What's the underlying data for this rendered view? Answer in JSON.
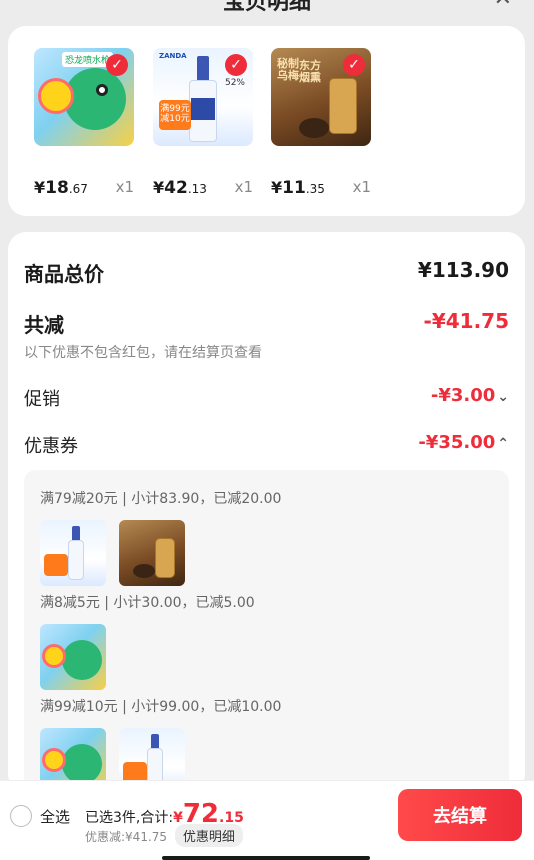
{
  "header": {
    "title": "宝贝明细",
    "close_icon": "close-icon"
  },
  "products": [
    {
      "price_symbol": "¥",
      "price_int": "18",
      "price_dec": ".67",
      "qty": "x1",
      "thumb": "water-gun-toy",
      "tag": "恐龙喷水枪"
    },
    {
      "price_symbol": "¥",
      "price_int": "42",
      "price_dec": ".13",
      "qty": "x1",
      "thumb": "liquor-bottle",
      "promo_head": "ZANDA",
      "promo_tag": "满99元减10元",
      "abv": "52%"
    },
    {
      "price_symbol": "¥",
      "price_int": "11",
      "price_dec": ".35",
      "qty": "x1",
      "thumb": "smoked-plum-drink",
      "plum_text_1": "秘制乌梅",
      "plum_text_2": "东方烟熏"
    }
  ],
  "detail": {
    "total_label": "商品总价",
    "total_value": "¥113.90",
    "reduce_label": "共减",
    "reduce_value": "-¥41.75",
    "note": "以下优惠不包含红包，请在结算页查看",
    "promo_label": "促销",
    "promo_value": "-¥3.00",
    "coupon_label": "优惠券",
    "coupon_value": "-¥35.00"
  },
  "coupon_groups": [
    {
      "title": "满79减20元 | 小计83.90，已减20.00",
      "items": [
        "liquor-bottle",
        "smoked-plum-drink"
      ]
    },
    {
      "title": "满8减5元 | 小计30.00，已减5.00",
      "items": [
        "water-gun-toy"
      ]
    },
    {
      "title": "满99减10元 | 小计99.00，已减10.00",
      "items": [
        "water-gun-toy",
        "liquor-bottle"
      ]
    }
  ],
  "bottom": {
    "select_all": "全选",
    "summary_prefix": "已选3件,合计:",
    "total_symbol": "¥",
    "total_int": "72",
    "total_dec": ".15",
    "discount_text": "优惠减:¥41.75",
    "detail_chip": "优惠明细",
    "checkout": "去结算"
  },
  "colors": {
    "accent_red": "#ef2c3a",
    "background": "#ececec"
  }
}
